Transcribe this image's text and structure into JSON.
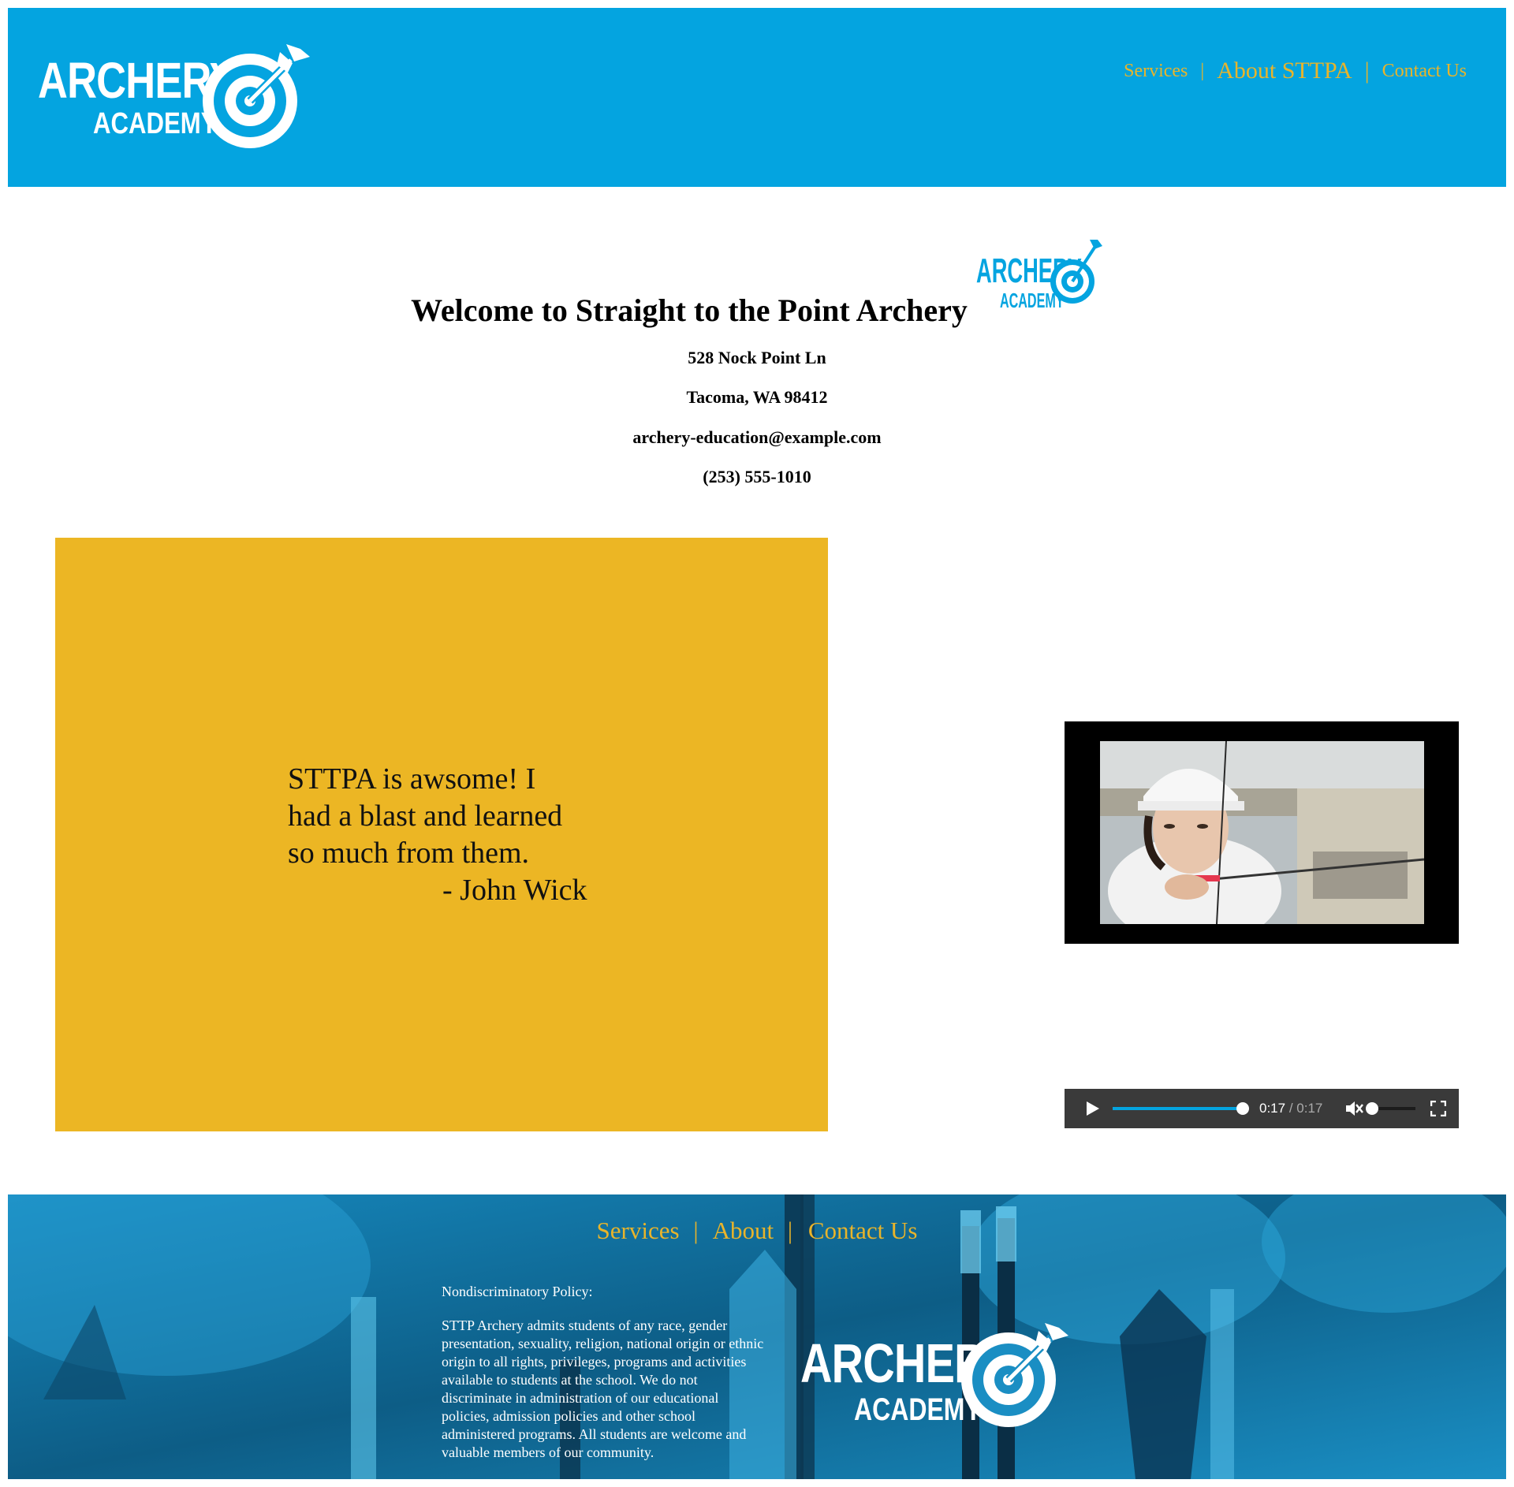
{
  "header": {
    "logo": {
      "line1": "ARCHERY",
      "line2": "ACADEMY",
      "icon": "target-arrow-icon"
    },
    "nav": [
      {
        "label": "Services"
      },
      {
        "label": "About STTPA"
      },
      {
        "label": "Contact Us"
      }
    ],
    "nav_separator": "|"
  },
  "welcome": {
    "title": "Welcome to Straight to the Point Archery",
    "logo": {
      "line1": "ARCHERY",
      "line2": "ACADEMY"
    },
    "address1": "528 Nock Point Ln",
    "address2": "Tacoma, WA 98412",
    "email": "archery-education@example.com",
    "phone": "(253) 555-1010"
  },
  "testimonial": {
    "lines": [
      "STTPA is awsome! I",
      "had a blast and learned",
      "so much from them."
    ],
    "author": "- John Wick"
  },
  "video": {
    "thumbnail": "archer-aiming-photo"
  },
  "audio": {
    "current_time": "0:17",
    "duration": "0:17",
    "time_separator": "/",
    "progress": 1.0,
    "volume": 0.0,
    "play_icon": "play-icon",
    "mute_icon": "muted-speaker-icon",
    "fullscreen_icon": "fullscreen-icon"
  },
  "footer": {
    "nav": [
      {
        "label": "Services"
      },
      {
        "label": "About"
      },
      {
        "label": "Contact Us"
      }
    ],
    "nav_separator": "|",
    "policy_title": "Nondiscriminatory Policy:",
    "policy_text": "STTP Archery admits students of any race, gender presentation, sexuality, religion, national origin or ethnic origin to all rights, privileges, programs and activities available to students at the school. We do not discriminate in administration of our educational policies, admission policies and other school administered programs. All students are welcome and valuable members of our community.",
    "logo": {
      "line1": "ARCHERY",
      "line2": "ACADEMY"
    }
  },
  "colors": {
    "header_bg": "#04a4e0",
    "nav_gold": "#e9b42a",
    "quote_bg": "#ecb624",
    "footer_bg": "#0e5f87"
  }
}
